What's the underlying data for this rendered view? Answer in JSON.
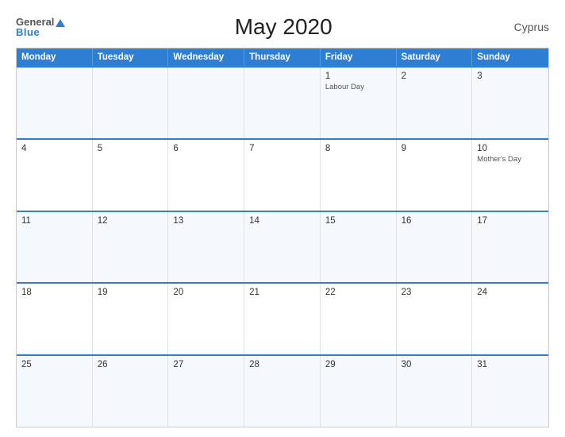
{
  "logo": {
    "general": "General",
    "blue": "Blue"
  },
  "title": "May 2020",
  "country": "Cyprus",
  "header": {
    "days": [
      "Monday",
      "Tuesday",
      "Wednesday",
      "Thursday",
      "Friday",
      "Saturday",
      "Sunday"
    ]
  },
  "weeks": [
    [
      {
        "day": "",
        "event": ""
      },
      {
        "day": "",
        "event": ""
      },
      {
        "day": "",
        "event": ""
      },
      {
        "day": "",
        "event": ""
      },
      {
        "day": "1",
        "event": "Labour Day"
      },
      {
        "day": "2",
        "event": ""
      },
      {
        "day": "3",
        "event": ""
      }
    ],
    [
      {
        "day": "4",
        "event": ""
      },
      {
        "day": "5",
        "event": ""
      },
      {
        "day": "6",
        "event": ""
      },
      {
        "day": "7",
        "event": ""
      },
      {
        "day": "8",
        "event": ""
      },
      {
        "day": "9",
        "event": ""
      },
      {
        "day": "10",
        "event": "Mother's Day"
      }
    ],
    [
      {
        "day": "11",
        "event": ""
      },
      {
        "day": "12",
        "event": ""
      },
      {
        "day": "13",
        "event": ""
      },
      {
        "day": "14",
        "event": ""
      },
      {
        "day": "15",
        "event": ""
      },
      {
        "day": "16",
        "event": ""
      },
      {
        "day": "17",
        "event": ""
      }
    ],
    [
      {
        "day": "18",
        "event": ""
      },
      {
        "day": "19",
        "event": ""
      },
      {
        "day": "20",
        "event": ""
      },
      {
        "day": "21",
        "event": ""
      },
      {
        "day": "22",
        "event": ""
      },
      {
        "day": "23",
        "event": ""
      },
      {
        "day": "24",
        "event": ""
      }
    ],
    [
      {
        "day": "25",
        "event": ""
      },
      {
        "day": "26",
        "event": ""
      },
      {
        "day": "27",
        "event": ""
      },
      {
        "day": "28",
        "event": ""
      },
      {
        "day": "29",
        "event": ""
      },
      {
        "day": "30",
        "event": ""
      },
      {
        "day": "31",
        "event": ""
      }
    ]
  ]
}
